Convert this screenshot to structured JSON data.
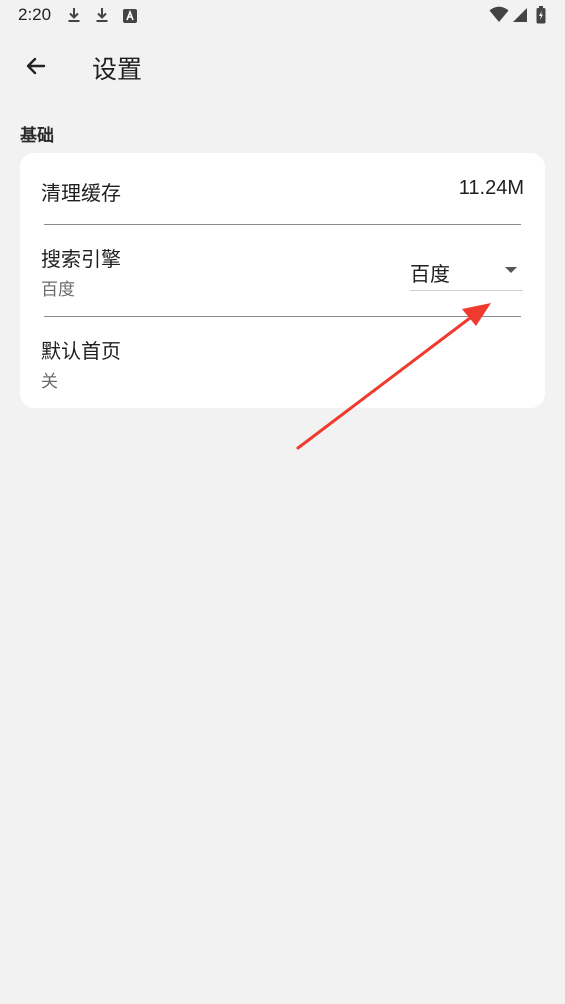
{
  "status_bar": {
    "time": "2:20",
    "icons": [
      "download-icon",
      "download-icon",
      "font-icon",
      "wifi-icon",
      "signal-icon",
      "battery-charging-icon"
    ]
  },
  "app_bar": {
    "back_icon": "arrow-left-icon",
    "title": "设置"
  },
  "section": {
    "title": "基础"
  },
  "settings": {
    "clear_cache": {
      "label": "清理缓存",
      "value": "11.24M"
    },
    "search_engine": {
      "label": "搜索引擎",
      "subtitle": "百度",
      "selected": "百度",
      "caret_icon": "caret-down-icon"
    },
    "default_homepage": {
      "label": "默认首页",
      "subtitle": "关"
    }
  },
  "annotation": {
    "type": "red-arrow",
    "color": "#f03a2e"
  },
  "colors": {
    "background": "#f2f2f2",
    "card": "#ffffff",
    "text_primary": "#1f1f1f",
    "text_secondary": "#6b6b6b",
    "annotation": "#f03a2e"
  }
}
